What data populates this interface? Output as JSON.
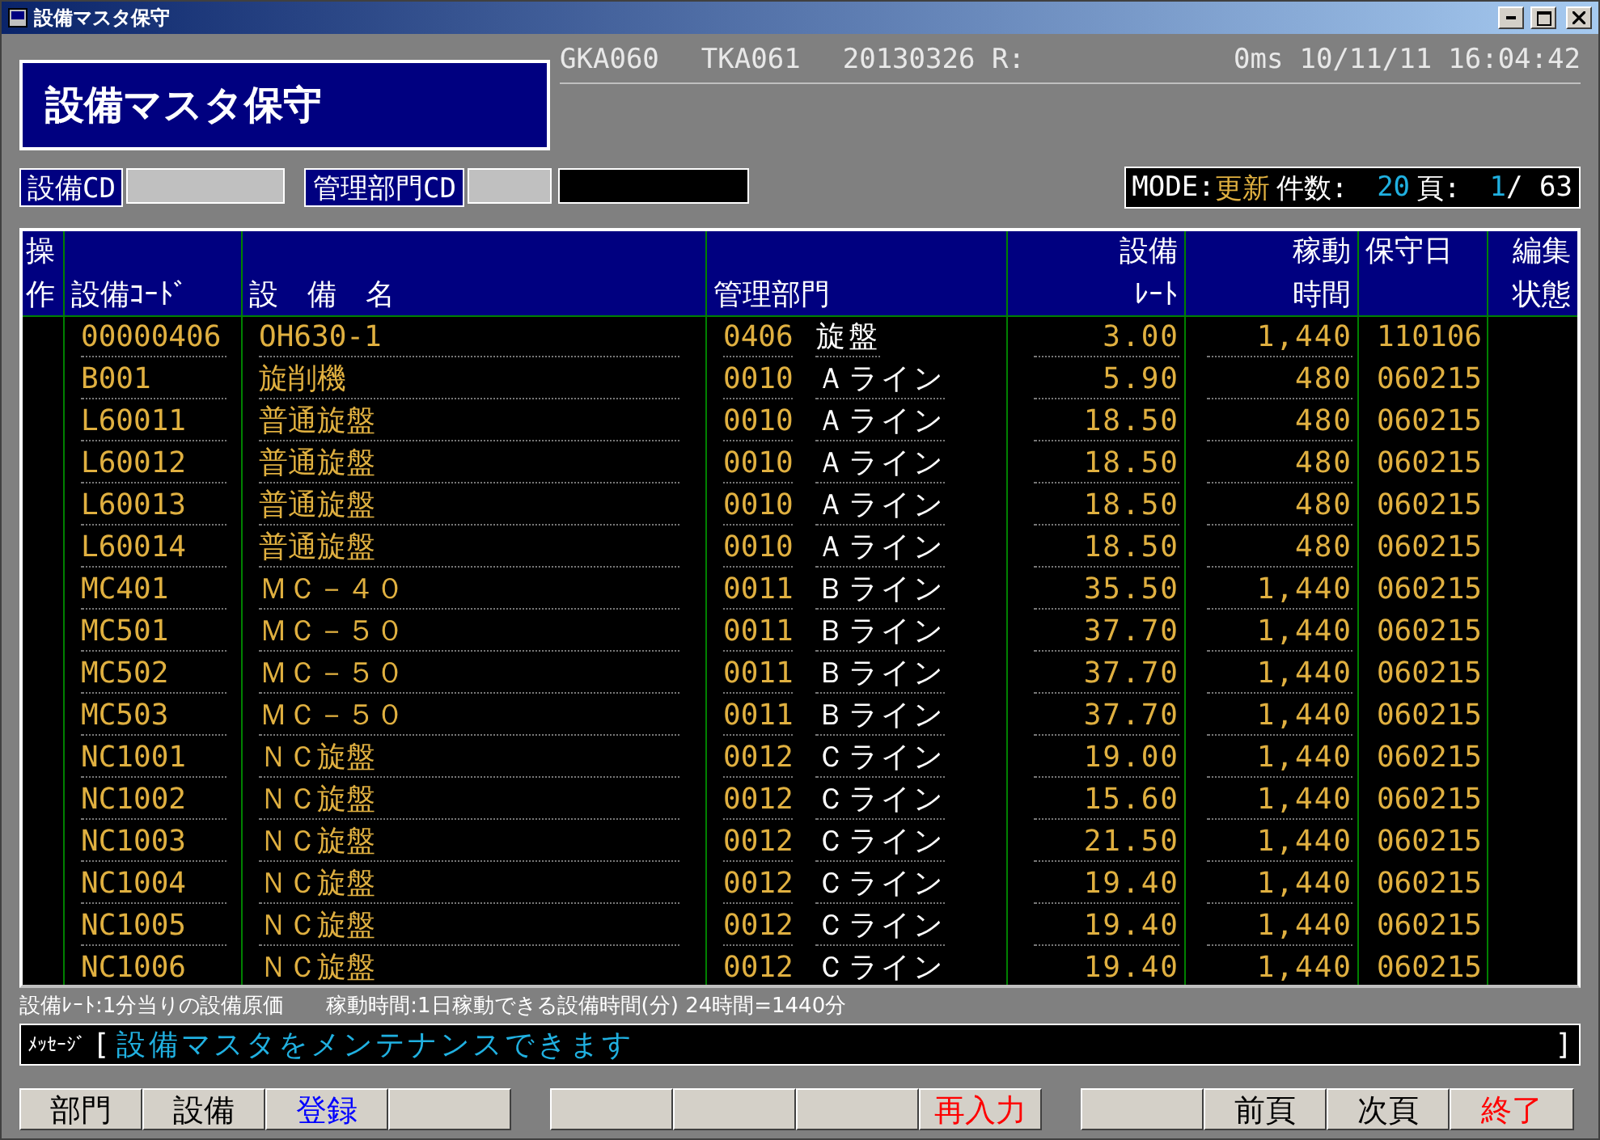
{
  "window": {
    "title": "設備マスタ保守"
  },
  "header": {
    "screen_title": "設備マスタ保守",
    "program_id": "GKA060",
    "terminal_id": "TKA061",
    "date_code": "20130326 R:",
    "elapsed": "0ms",
    "date": "10/11/11",
    "time": "16:04:42"
  },
  "filters": [
    {
      "label": "設備CD",
      "kind": "code"
    },
    {
      "label": "管理部門CD",
      "kind": "code_name"
    }
  ],
  "status": {
    "mode_label": "MODE:",
    "mode": "更新",
    "count_label": "件数:",
    "count": "20",
    "page_label": "頁:",
    "page": "1",
    "page_total": "/ 63"
  },
  "table": {
    "columns": [
      {
        "top": "操",
        "bottom": "作"
      },
      {
        "bottom": "設備ｺｰﾄﾞ"
      },
      {
        "bottom": "設　備　名"
      },
      {
        "bottom": "管理部門"
      },
      {
        "top": "設備",
        "bottom": "ﾚｰﾄ"
      },
      {
        "top": "稼動",
        "bottom": "時間"
      },
      {
        "top": "保守日"
      },
      {
        "top": "編集",
        "bottom": "状態"
      }
    ],
    "rows": [
      {
        "code": "00000406",
        "name": "OH630-1",
        "dept_code": "0406",
        "dept_name": "旋盤",
        "rate": "3.00",
        "hours": "1,440",
        "date": "110106"
      },
      {
        "code": "B001",
        "name": "旋削機",
        "dept_code": "0010",
        "dept_name": "Ａライン",
        "rate": "5.90",
        "hours": "480",
        "date": "060215"
      },
      {
        "code": "L60011",
        "name": "普通旋盤",
        "dept_code": "0010",
        "dept_name": "Ａライン",
        "rate": "18.50",
        "hours": "480",
        "date": "060215"
      },
      {
        "code": "L60012",
        "name": "普通旋盤",
        "dept_code": "0010",
        "dept_name": "Ａライン",
        "rate": "18.50",
        "hours": "480",
        "date": "060215"
      },
      {
        "code": "L60013",
        "name": "普通旋盤",
        "dept_code": "0010",
        "dept_name": "Ａライン",
        "rate": "18.50",
        "hours": "480",
        "date": "060215"
      },
      {
        "code": "L60014",
        "name": "普通旋盤",
        "dept_code": "0010",
        "dept_name": "Ａライン",
        "rate": "18.50",
        "hours": "480",
        "date": "060215"
      },
      {
        "code": "MC401",
        "name": "ＭＣ－４０",
        "dept_code": "0011",
        "dept_name": "Ｂライン",
        "rate": "35.50",
        "hours": "1,440",
        "date": "060215"
      },
      {
        "code": "MC501",
        "name": "ＭＣ－５０",
        "dept_code": "0011",
        "dept_name": "Ｂライン",
        "rate": "37.70",
        "hours": "1,440",
        "date": "060215"
      },
      {
        "code": "MC502",
        "name": "ＭＣ－５０",
        "dept_code": "0011",
        "dept_name": "Ｂライン",
        "rate": "37.70",
        "hours": "1,440",
        "date": "060215"
      },
      {
        "code": "MC503",
        "name": "ＭＣ－５０",
        "dept_code": "0011",
        "dept_name": "Ｂライン",
        "rate": "37.70",
        "hours": "1,440",
        "date": "060215"
      },
      {
        "code": "NC1001",
        "name": "ＮＣ旋盤",
        "dept_code": "0012",
        "dept_name": "Ｃライン",
        "rate": "19.00",
        "hours": "1,440",
        "date": "060215"
      },
      {
        "code": "NC1002",
        "name": "ＮＣ旋盤",
        "dept_code": "0012",
        "dept_name": "Ｃライン",
        "rate": "15.60",
        "hours": "1,440",
        "date": "060215"
      },
      {
        "code": "NC1003",
        "name": "ＮＣ旋盤",
        "dept_code": "0012",
        "dept_name": "Ｃライン",
        "rate": "21.50",
        "hours": "1,440",
        "date": "060215"
      },
      {
        "code": "NC1004",
        "name": "ＮＣ旋盤",
        "dept_code": "0012",
        "dept_name": "Ｃライン",
        "rate": "19.40",
        "hours": "1,440",
        "date": "060215"
      },
      {
        "code": "NC1005",
        "name": "ＮＣ旋盤",
        "dept_code": "0012",
        "dept_name": "Ｃライン",
        "rate": "19.40",
        "hours": "1,440",
        "date": "060215"
      },
      {
        "code": "NC1006",
        "name": "ＮＣ旋盤",
        "dept_code": "0012",
        "dept_name": "Ｃライン",
        "rate": "19.40",
        "hours": "1,440",
        "date": "060215"
      }
    ]
  },
  "hint": "設備ﾚｰﾄ:1分当りの設備原価　　稼動時間:1日稼動できる設備時間(分) 24時間=1440分",
  "message": {
    "label": "ﾒｯｾｰｼﾞ",
    "open": "[",
    "text": "設備マスタをメンテナンスできます",
    "close": "]"
  },
  "function_keys": [
    [
      {
        "kind": "key",
        "label": "部門",
        "color": "#000000"
      },
      {
        "kind": "key",
        "label": "設備",
        "color": "#000000"
      },
      {
        "kind": "key",
        "label": "登録",
        "color": "#0000ff"
      },
      {
        "kind": "blank"
      }
    ],
    [
      {
        "kind": "blank"
      },
      {
        "kind": "blank"
      },
      {
        "kind": "blank"
      },
      {
        "kind": "key",
        "label": "再入力",
        "color": "#ff0000"
      }
    ],
    [
      {
        "kind": "blank"
      },
      {
        "kind": "key",
        "label": "前頁",
        "color": "#000000"
      },
      {
        "kind": "key",
        "label": "次頁",
        "color": "#000000"
      },
      {
        "kind": "key",
        "label": "終了",
        "color": "#ff0000"
      }
    ]
  ]
}
